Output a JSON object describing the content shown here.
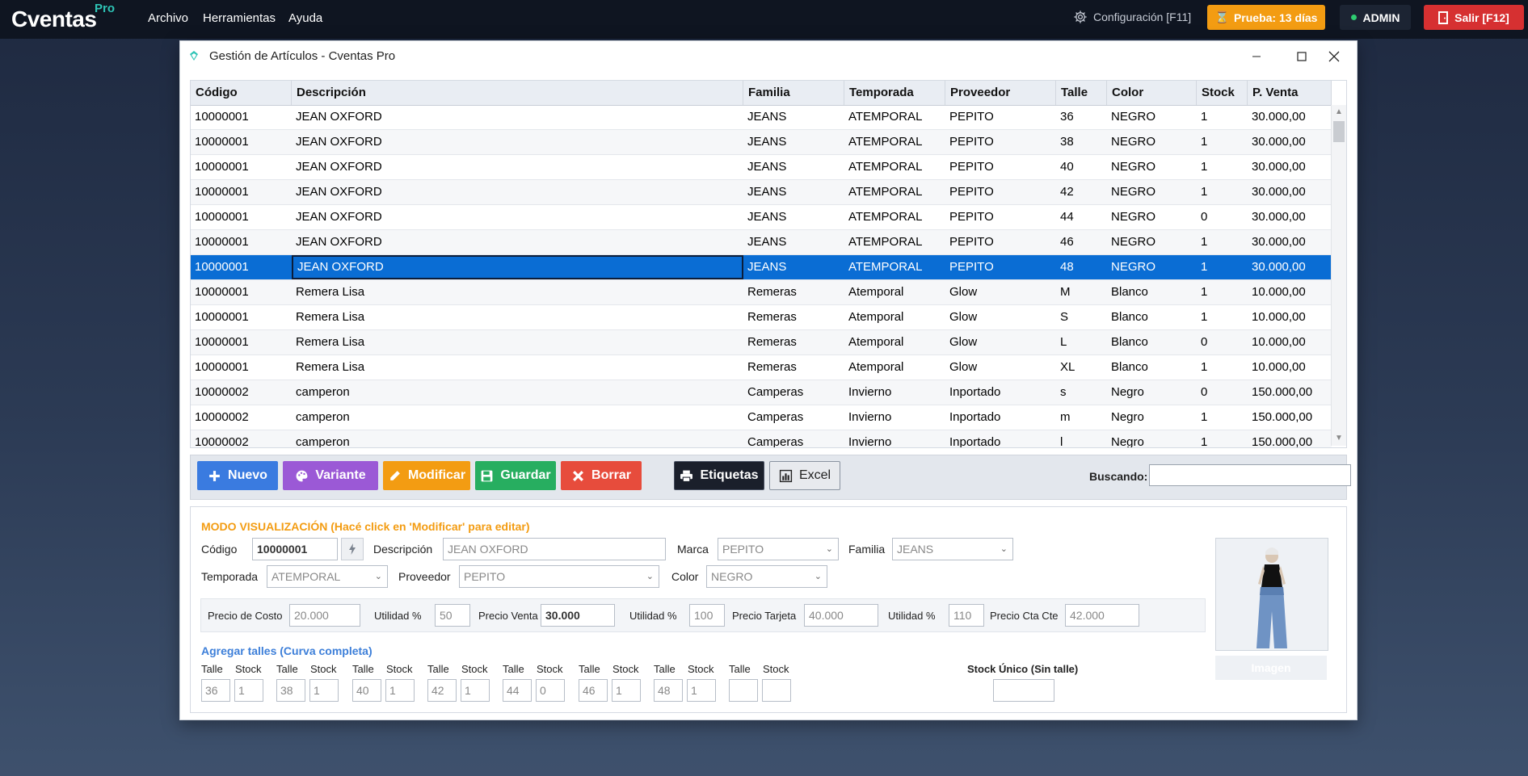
{
  "app": {
    "logo": "Cventas",
    "logo_sup": "Pro",
    "menu": [
      "Archivo",
      "Herramientas",
      "Ayuda"
    ],
    "config_label": "Configuración [F11]",
    "trial_label": "Prueba: 13 días",
    "user_label": "ADMIN",
    "logout_label": "Salir [F12]"
  },
  "window": {
    "title": "Gestión de Artículos - Cventas Pro"
  },
  "grid": {
    "columns": [
      "Código",
      "Descripción",
      "Familia",
      "Temporada",
      "Proveedor",
      "Talle",
      "Color",
      "Stock",
      "P. Venta"
    ],
    "selected_row": 6,
    "rows": [
      [
        "10000001",
        "JEAN OXFORD",
        "JEANS",
        "ATEMPORAL",
        "PEPITO",
        "36",
        "NEGRO",
        "1",
        "30.000,00"
      ],
      [
        "10000001",
        "JEAN OXFORD",
        "JEANS",
        "ATEMPORAL",
        "PEPITO",
        "38",
        "NEGRO",
        "1",
        "30.000,00"
      ],
      [
        "10000001",
        "JEAN OXFORD",
        "JEANS",
        "ATEMPORAL",
        "PEPITO",
        "40",
        "NEGRO",
        "1",
        "30.000,00"
      ],
      [
        "10000001",
        "JEAN OXFORD",
        "JEANS",
        "ATEMPORAL",
        "PEPITO",
        "42",
        "NEGRO",
        "1",
        "30.000,00"
      ],
      [
        "10000001",
        "JEAN OXFORD",
        "JEANS",
        "ATEMPORAL",
        "PEPITO",
        "44",
        "NEGRO",
        "0",
        "30.000,00"
      ],
      [
        "10000001",
        "JEAN OXFORD",
        "JEANS",
        "ATEMPORAL",
        "PEPITO",
        "46",
        "NEGRO",
        "1",
        "30.000,00"
      ],
      [
        "10000001",
        "JEAN OXFORD",
        "JEANS",
        "ATEMPORAL",
        "PEPITO",
        "48",
        "NEGRO",
        "1",
        "30.000,00"
      ],
      [
        "10000001",
        "Remera Lisa",
        "Remeras",
        "Atemporal",
        "Glow",
        "M",
        "Blanco",
        "1",
        "10.000,00"
      ],
      [
        "10000001",
        "Remera Lisa",
        "Remeras",
        "Atemporal",
        "Glow",
        "S",
        "Blanco",
        "1",
        "10.000,00"
      ],
      [
        "10000001",
        "Remera Lisa",
        "Remeras",
        "Atemporal",
        "Glow",
        "L",
        "Blanco",
        "0",
        "10.000,00"
      ],
      [
        "10000001",
        "Remera Lisa",
        "Remeras",
        "Atemporal",
        "Glow",
        "XL",
        "Blanco",
        "1",
        "10.000,00"
      ],
      [
        "10000002",
        "camperon",
        "Camperas",
        "Invierno",
        "Inportado",
        "s",
        "Negro",
        "0",
        "150.000,00"
      ],
      [
        "10000002",
        "camperon",
        "Camperas",
        "Invierno",
        "Inportado",
        "m",
        "Negro",
        "1",
        "150.000,00"
      ],
      [
        "10000002",
        "camperon",
        "Camperas",
        "Invierno",
        "Inportado",
        "l",
        "Negro",
        "1",
        "150.000,00"
      ]
    ]
  },
  "toolbar": {
    "new": "Nuevo",
    "variant": "Variante",
    "modify": "Modificar",
    "save": "Guardar",
    "delete": "Borrar",
    "labels": "Etiquetas",
    "excel": "Excel",
    "search_label": "Buscando:",
    "search_value": ""
  },
  "colors": {
    "new": "#3a7be0",
    "variant": "#9b59d6",
    "modify": "#f39c12",
    "save": "#27ae60",
    "delete": "#e74c3c",
    "labels": "#1a1f2b",
    "selection": "#0a6dd4",
    "mode_label": "#f39c12",
    "section_label": "#3d7fd9"
  },
  "form": {
    "mode_label": "MODO VISUALIZACIÓN (Hacé click en 'Modificar' para editar)",
    "codigo_label": "Código",
    "codigo_value": "10000001",
    "descripcion_label": "Descripción",
    "descripcion_value": "JEAN OXFORD",
    "marca_label": "Marca",
    "marca_value": "PEPITO",
    "familia_label": "Familia",
    "familia_value": "JEANS",
    "temporada_label": "Temporada",
    "temporada_value": "ATEMPORAL",
    "proveedor_label": "Proveedor",
    "proveedor_value": "PEPITO",
    "color_label": "Color",
    "color_value": "NEGRO",
    "precio_costo_label": "Precio de Costo",
    "precio_costo_value": "20.000",
    "utilidad1_label": "Utilidad %",
    "utilidad1_value": "50",
    "precio_venta_label": "Precio Venta",
    "precio_venta_value": "30.000",
    "utilidad2_label": "Utilidad %",
    "utilidad2_value": "100",
    "precio_tarjeta_label": "Precio Tarjeta",
    "precio_tarjeta_value": "40.000",
    "utilidad3_label": "Utilidad %",
    "utilidad3_value": "110",
    "precio_ctacte_label": "Precio Cta Cte",
    "precio_ctacte_value": "42.000",
    "sizes_section": "Agregar talles (Curva completa)",
    "talle_label": "Talle",
    "stock_label": "Stock",
    "sizes": [
      {
        "talle": "36",
        "stock": "1"
      },
      {
        "talle": "38",
        "stock": "1"
      },
      {
        "talle": "40",
        "stock": "1"
      },
      {
        "talle": "42",
        "stock": "1"
      },
      {
        "talle": "44",
        "stock": "0"
      },
      {
        "talle": "46",
        "stock": "1"
      },
      {
        "talle": "48",
        "stock": "1"
      },
      {
        "talle": "",
        "stock": ""
      }
    ],
    "stock_unico_label": "Stock Único (Sin talle)",
    "stock_unico_value": "",
    "image_button": "Imagen"
  }
}
